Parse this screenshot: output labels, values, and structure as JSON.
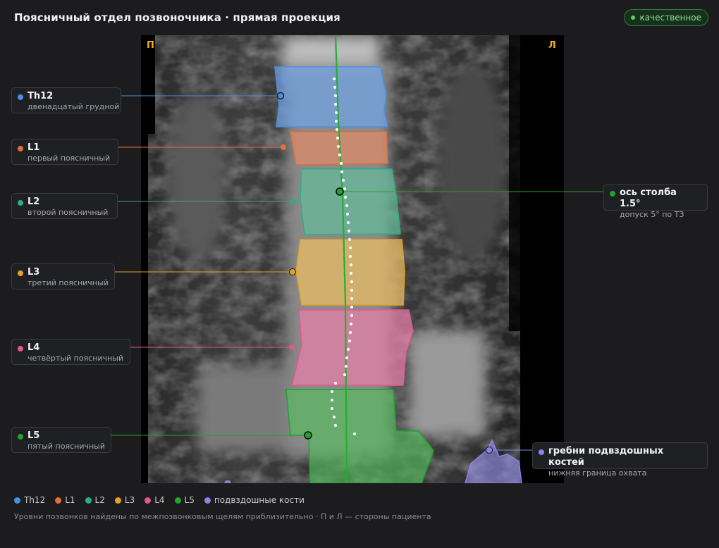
{
  "header": {
    "title": "Поясничный отдел позвоночника · прямая проекция",
    "badge": "качественное"
  },
  "image": {
    "side_right_marker": "П",
    "side_left_marker": "Л"
  },
  "vertebrae": [
    {
      "id": "th12",
      "name": "Th12",
      "desc": "двенадцатый грудной",
      "color": "#4a90e2"
    },
    {
      "id": "l1",
      "name": "L1",
      "desc": "первый поясничный",
      "color": "#e0703a"
    },
    {
      "id": "l2",
      "name": "L2",
      "desc": "второй поясничный",
      "color": "#2fae86"
    },
    {
      "id": "l3",
      "name": "L3",
      "desc": "третий поясничный",
      "color": "#e3a02a"
    },
    {
      "id": "l4",
      "name": "L4",
      "desc": "четвёртый поясничный",
      "color": "#e0598a"
    },
    {
      "id": "l5",
      "name": "L5",
      "desc": "пятый поясничный",
      "color": "#22a22e"
    }
  ],
  "axis_label": {
    "name": "ось столба 1.5°",
    "desc": "допуск 5° по ТЗ",
    "color": "#22a22e"
  },
  "iliac_label": {
    "name": "гребни подвздошных костей",
    "desc": "нижняя граница охвата",
    "color": "#8a83e8"
  },
  "legend": [
    {
      "label": "Th12",
      "color": "#4a90e2"
    },
    {
      "label": "L1",
      "color": "#e0703a"
    },
    {
      "label": "L2",
      "color": "#2fae86"
    },
    {
      "label": "L3",
      "color": "#e3a02a"
    },
    {
      "label": "L4",
      "color": "#e0598a"
    },
    {
      "label": "L5",
      "color": "#22a22e"
    },
    {
      "label": "подвздошные кости",
      "color": "#8a83e8"
    }
  ],
  "footnote": "Уровни позвонков найдены по межпозвонковым щелям приблизительно · П и Л — стороны пациента"
}
